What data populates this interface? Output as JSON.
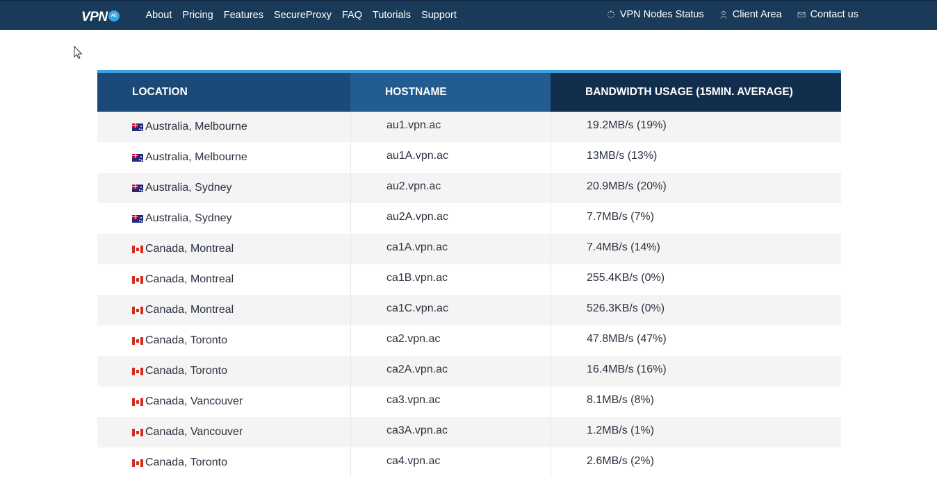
{
  "header": {
    "logo_text": "VPN",
    "logo_badge": "AC",
    "nav_left": [
      "About",
      "Pricing",
      "Features",
      "SecureProxy",
      "FAQ",
      "Tutorials",
      "Support"
    ],
    "nav_right": {
      "status": "VPN Nodes Status",
      "client": "Client Area",
      "contact": "Contact us"
    }
  },
  "table": {
    "accent_color": "#3ea0dc",
    "headers": {
      "location": "LOCATION",
      "hostname": "HOSTNAME",
      "bandwidth": "BANDWIDTH USAGE (15MIN. AVERAGE)"
    },
    "rows": [
      {
        "flag": "au",
        "location": "Australia, Melbourne",
        "hostname": "au1.vpn.ac",
        "bandwidth": "19.2MB/s (19%)"
      },
      {
        "flag": "au",
        "location": "Australia, Melbourne",
        "hostname": "au1A.vpn.ac",
        "bandwidth": "13MB/s (13%)"
      },
      {
        "flag": "au",
        "location": "Australia, Sydney",
        "hostname": "au2.vpn.ac",
        "bandwidth": "20.9MB/s (20%)"
      },
      {
        "flag": "au",
        "location": "Australia, Sydney",
        "hostname": "au2A.vpn.ac",
        "bandwidth": "7.7MB/s (7%)"
      },
      {
        "flag": "ca",
        "location": "Canada, Montreal",
        "hostname": "ca1A.vpn.ac",
        "bandwidth": "7.4MB/s (14%)"
      },
      {
        "flag": "ca",
        "location": "Canada, Montreal",
        "hostname": "ca1B.vpn.ac",
        "bandwidth": "255.4KB/s (0%)"
      },
      {
        "flag": "ca",
        "location": "Canada, Montreal",
        "hostname": "ca1C.vpn.ac",
        "bandwidth": "526.3KB/s (0%)"
      },
      {
        "flag": "ca",
        "location": "Canada, Toronto",
        "hostname": "ca2.vpn.ac",
        "bandwidth": "47.8MB/s (47%)"
      },
      {
        "flag": "ca",
        "location": "Canada, Toronto",
        "hostname": "ca2A.vpn.ac",
        "bandwidth": "16.4MB/s (16%)"
      },
      {
        "flag": "ca",
        "location": "Canada, Vancouver",
        "hostname": "ca3.vpn.ac",
        "bandwidth": "8.1MB/s (8%)"
      },
      {
        "flag": "ca",
        "location": "Canada, Vancouver",
        "hostname": "ca3A.vpn.ac",
        "bandwidth": "1.2MB/s (1%)"
      },
      {
        "flag": "ca",
        "location": "Canada, Toronto",
        "hostname": "ca4.vpn.ac",
        "bandwidth": "2.6MB/s (2%)"
      }
    ]
  }
}
